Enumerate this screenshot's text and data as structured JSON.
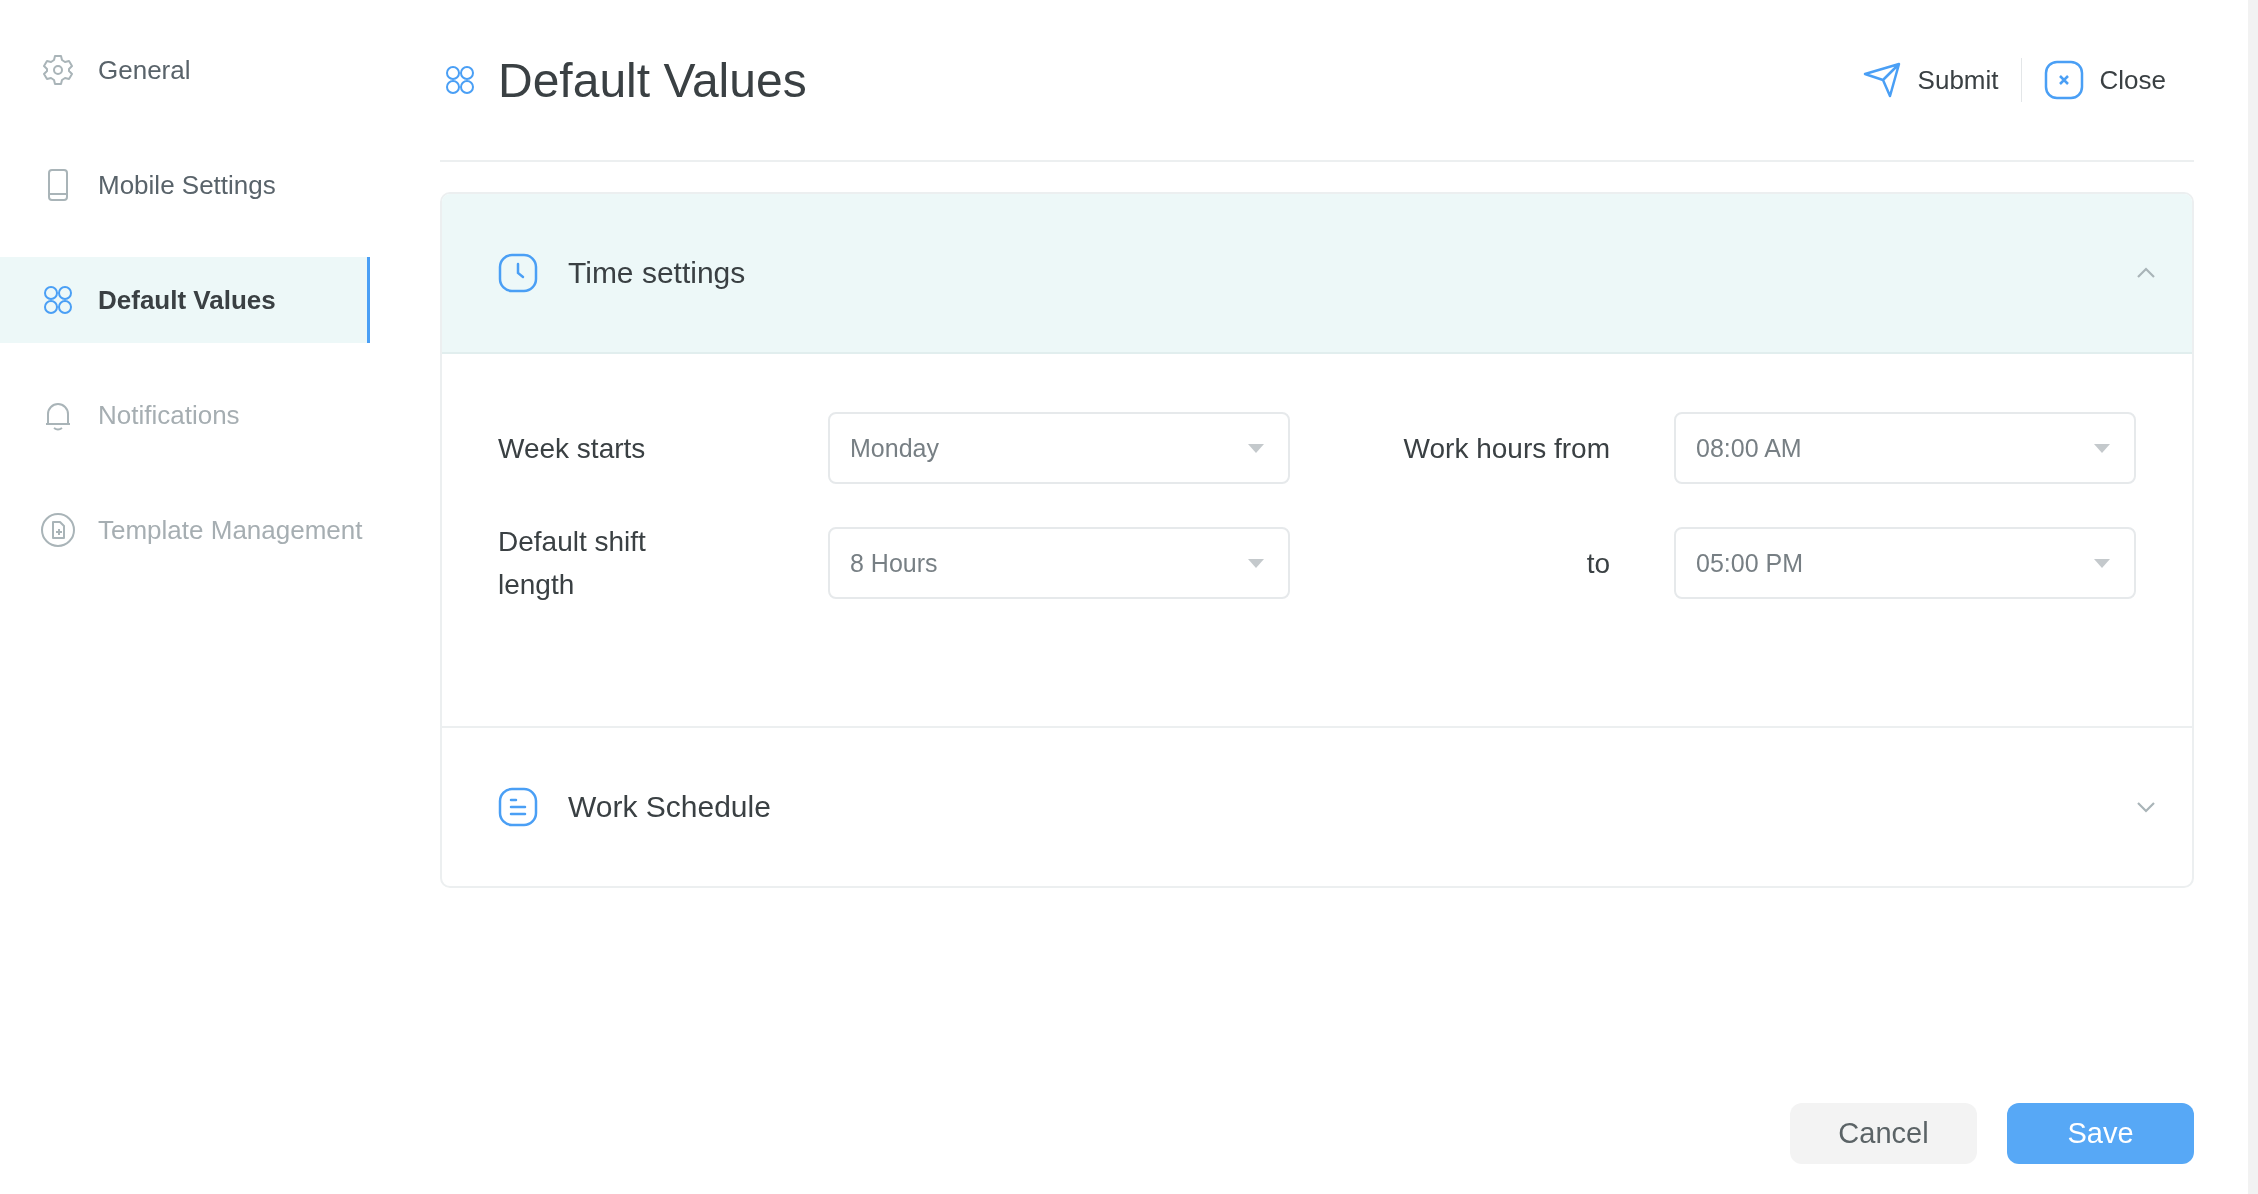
{
  "sidebar": {
    "items": [
      {
        "label": "General",
        "selected": false,
        "disabled": false
      },
      {
        "label": "Mobile Settings",
        "selected": false,
        "disabled": false
      },
      {
        "label": "Default Values",
        "selected": true,
        "disabled": false
      },
      {
        "label": "Notifications",
        "selected": false,
        "disabled": true
      },
      {
        "label": "Template Management",
        "selected": false,
        "disabled": true
      }
    ]
  },
  "header": {
    "title": "Default Values",
    "actions": [
      {
        "label": "Submit"
      },
      {
        "label": "Close"
      }
    ]
  },
  "sections": [
    {
      "title": "Time settings",
      "expanded": true,
      "fields": [
        {
          "label": "Week starts",
          "value": "Monday"
        },
        {
          "label": "Work hours from",
          "value": "08:00 AM"
        },
        {
          "label": "Default shift length",
          "value": "8 Hours"
        },
        {
          "label": "to",
          "value": "05:00 PM"
        }
      ]
    },
    {
      "title": "Work Schedule",
      "expanded": false
    }
  ],
  "footer": {
    "buttons": [
      "Cancel",
      "Save"
    ]
  }
}
